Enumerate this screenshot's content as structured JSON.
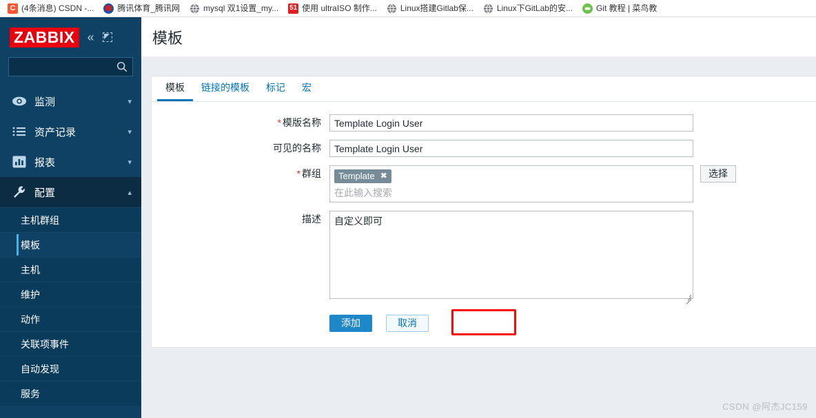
{
  "browser": {
    "bookmarks": [
      {
        "icon": "csdn-favicon",
        "label": "(4条消息) CSDN -..."
      },
      {
        "icon": "tencent-favicon",
        "label": "腾讯体育_腾讯网"
      },
      {
        "icon": "globe-favicon",
        "label": "mysql 双1设置_my..."
      },
      {
        "icon": "51-favicon",
        "label": "使用 ultraISO 制作..."
      },
      {
        "icon": "globe-favicon",
        "label": "Linux搭建Gitlab保..."
      },
      {
        "icon": "globe-favicon",
        "label": "Linux下GitLab的安..."
      },
      {
        "icon": "git-favicon",
        "label": "Git 教程 | 菜鸟教"
      }
    ]
  },
  "sidebar": {
    "logo_text": "ZABBIX",
    "collapse_icon": "double-chevron-left-icon",
    "kiosk_icon": "kiosk-mode-icon",
    "search": {
      "value": "",
      "placeholder": ""
    },
    "nav": [
      {
        "icon": "eye-icon",
        "label": "监测",
        "chevron": "chevron-down-icon",
        "active": false
      },
      {
        "icon": "list-icon",
        "label": "资产记录",
        "chevron": "chevron-down-icon",
        "active": false
      },
      {
        "icon": "chart-icon",
        "label": "报表",
        "chevron": "chevron-down-icon",
        "active": false
      },
      {
        "icon": "wrench-icon",
        "label": "配置",
        "chevron": "chevron-up-icon",
        "active": true
      }
    ],
    "submenu": [
      {
        "label": "主机群组",
        "selected": false
      },
      {
        "label": "模板",
        "selected": true
      },
      {
        "label": "主机",
        "selected": false
      },
      {
        "label": "维护",
        "selected": false
      },
      {
        "label": "动作",
        "selected": false
      },
      {
        "label": "关联项事件",
        "selected": false
      },
      {
        "label": "自动发现",
        "selected": false
      },
      {
        "label": "服务",
        "selected": false
      }
    ]
  },
  "page": {
    "title": "模板",
    "tabs": [
      {
        "label": "模板",
        "active": true
      },
      {
        "label": "链接的模板",
        "active": false
      },
      {
        "label": "标记",
        "active": false
      },
      {
        "label": "宏",
        "active": false
      }
    ]
  },
  "form": {
    "template_name": {
      "label": "模版名称",
      "required": true,
      "value": "Template Login User",
      "placeholder": ""
    },
    "visible_name": {
      "label": "可见的名称",
      "required": false,
      "value": "Template Login User",
      "placeholder": ""
    },
    "groups": {
      "label": "群组",
      "required": true,
      "chip": "Template",
      "chip_remove_icon": "close-icon",
      "placeholder": "在此输入搜索",
      "select_button": "选择"
    },
    "description": {
      "label": "描述",
      "required": false,
      "value": "自定义即可",
      "placeholder": ""
    },
    "buttons": {
      "submit": "添加",
      "cancel": "取消"
    }
  },
  "annotation": {
    "highlight_color": "#fb0a0a",
    "target": "添加"
  },
  "watermark": "CSDN @阿杰JC159"
}
